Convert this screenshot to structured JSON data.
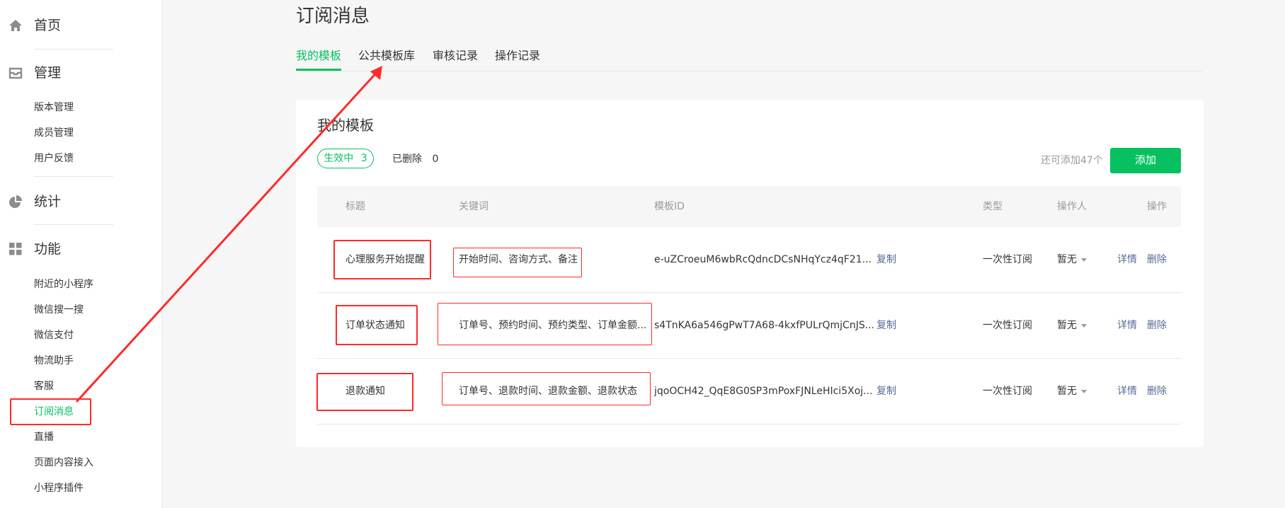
{
  "sidebar": {
    "groups": [
      {
        "label": "首页",
        "icon": "home-icon"
      },
      {
        "label": "管理",
        "icon": "inbox-icon"
      },
      {
        "label": "统计",
        "icon": "pie-chart-icon"
      },
      {
        "label": "功能",
        "icon": "grid-icon"
      }
    ],
    "manage_items": [
      "版本管理",
      "成员管理",
      "用户反馈"
    ],
    "feature_items": [
      "附近的小程序",
      "微信搜一搜",
      "微信支付",
      "物流助手",
      "客服",
      "订阅消息",
      "直播",
      "页面内容接入",
      "小程序插件"
    ],
    "active_item": "订阅消息"
  },
  "page": {
    "title": "订阅消息"
  },
  "tabs": [
    "我的模板",
    "公共模板库",
    "审核记录",
    "操作记录"
  ],
  "card": {
    "title": "我的模板",
    "filter_active_label": "生效中",
    "filter_active_count": "3",
    "filter_deleted_label": "已删除",
    "filter_deleted_count": "0",
    "remain_text": "还可添加47个",
    "add_label": "添加"
  },
  "table": {
    "headers": [
      "标题",
      "关键词",
      "模板ID",
      "类型",
      "操作人",
      "操作"
    ],
    "rows": [
      {
        "title": "心理服务开始提醒",
        "keywords": "开始时间、咨询方式、备注",
        "template_id": "e-uZCroeuM6wbRcQdncDCsNHqYcz4qF21...",
        "copy": "复制",
        "type": "一次性订阅",
        "operator": "暂无",
        "detail": "详情",
        "delete": "删除"
      },
      {
        "title": "订单状态通知",
        "keywords": "订单号、预约时间、预约类型、订单金额...",
        "template_id": "s4TnKA6a546gPwT7A68-4kxfPULrQmjCnJS...",
        "copy": "复制",
        "type": "一次性订阅",
        "operator": "暂无",
        "detail": "详情",
        "delete": "删除"
      },
      {
        "title": "退款通知",
        "keywords": "订单号、退款时间、退款金额、退款状态",
        "template_id": "jqoOCH42_QqE8G0SP3mPoxFJNLeHIci5Xoj...",
        "copy": "复制",
        "type": "一次性订阅",
        "operator": "暂无",
        "detail": "详情",
        "delete": "删除"
      }
    ]
  },
  "colors": {
    "accent": "#07c160",
    "link": "#576b95",
    "annotation": "#ff2a2a"
  }
}
